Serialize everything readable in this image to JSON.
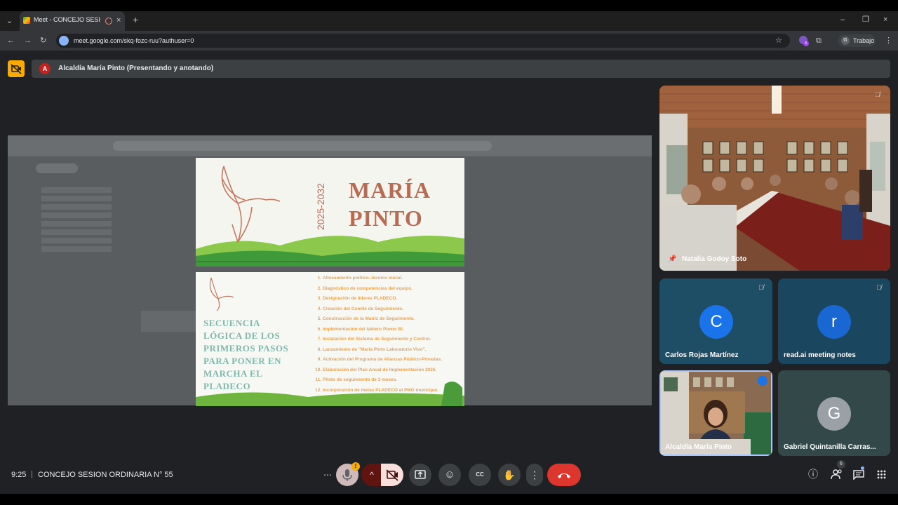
{
  "browser": {
    "tab_title": "Meet - CONCEJO SESION O",
    "new_tab": "+",
    "url": "meet.google.com/skq-fozc-ruu?authuser=0",
    "profile_label": "Trabajo",
    "profile_initial": "G",
    "extension_badge": "5"
  },
  "meet": {
    "presenter_initial": "A",
    "presenter_banner": "Alcaldía María Pinto (Presentando y anotando)",
    "time": "9:25",
    "separator": "|",
    "meeting_title": "CONCEJO SESION ORDINARIA N° 55",
    "people_count": "6"
  },
  "slide": {
    "title_line1": "MARÍA",
    "title_line2": "PINTO",
    "years": "2025-2032",
    "sequence_title_lines": [
      "SECUENCIA",
      "LÓGICA DE LOS",
      "PRIMEROS PASOS",
      "PARA PONER EN",
      "MARCHA EL",
      "PLADECO"
    ],
    "steps": [
      "Alineamiento político–técnico inicial.",
      "Diagnóstico de competencias del equipo.",
      "Designación de líderes PLADECO.",
      "Creación del Comité de Seguimiento.",
      "Construcción de la Matriz de Seguimiento.",
      "Implementación del tablero Power BI.",
      "Instalación del Sistema de Seguimiento y Control.",
      "Lanzamiento de \"María Pinto Laboratorio Vivo\".",
      "Activación del Programa de Alianzas Público-Privadas.",
      "Elaboración del Plan Anual de Implementación 2026.",
      "Piloto de seguimiento de 3 meses.",
      "Incorporación de metas PLADECO al PMG municipal."
    ]
  },
  "participants": [
    {
      "name": "Natalia Godoy Soto",
      "initial": ""
    },
    {
      "name": "Carlos Rojas Martínez",
      "initial": "C",
      "color": "#1a73e8"
    },
    {
      "name": "read.ai meeting notes",
      "initial": "r",
      "color": "#1967d2"
    },
    {
      "name": "Alcaldía María Pinto",
      "initial": ""
    },
    {
      "name": "Gabriel Quintanilla Carras...",
      "initial": "G",
      "color": "#9aa0a6"
    }
  ],
  "icons": {
    "more": "⋯",
    "mic": "🎙",
    "warn": "!",
    "chevron": "^",
    "present": "⬆",
    "emoji": "☺",
    "captions": "CC",
    "hand": "✋",
    "kebab": "⋮",
    "info": "ⓘ",
    "chat": "✉",
    "apps": "⁞⁞",
    "star": "☆",
    "pin": "📌"
  }
}
